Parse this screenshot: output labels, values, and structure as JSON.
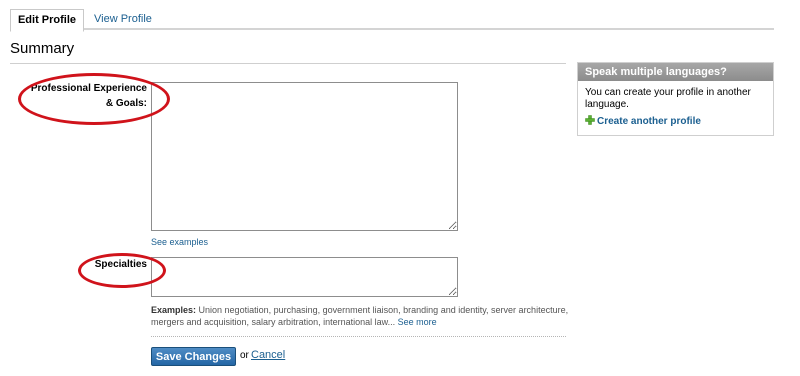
{
  "tabs": {
    "edit_profile": "Edit Profile",
    "view_profile": "View Profile"
  },
  "section": {
    "title": "Summary"
  },
  "form": {
    "experience_label_line1": "Professional Experience",
    "experience_label_line2": "& Goals:",
    "experience_value": "",
    "see_examples_link": "See examples",
    "specialties_label": "Specialties",
    "specialties_value": "",
    "examples_prefix": "Examples:",
    "examples_text": " Union negotiation, purchasing, government liaison, branding and identity, server architecture, mergers and acquisition, salary arbitration, international law...",
    "see_more_link": "See more",
    "save_label": "Save Changes",
    "or_text": "or",
    "cancel_label": "Cancel"
  },
  "sidebar": {
    "title": "Speak multiple languages?",
    "body": "You can create your profile in another language.",
    "create_link": "Create another profile",
    "plus_icon": "plus-icon"
  },
  "colors": {
    "link": "#1b5f90",
    "highlight": "#d0131b",
    "button": "#2466a5",
    "sidebar_header": "#999999"
  }
}
